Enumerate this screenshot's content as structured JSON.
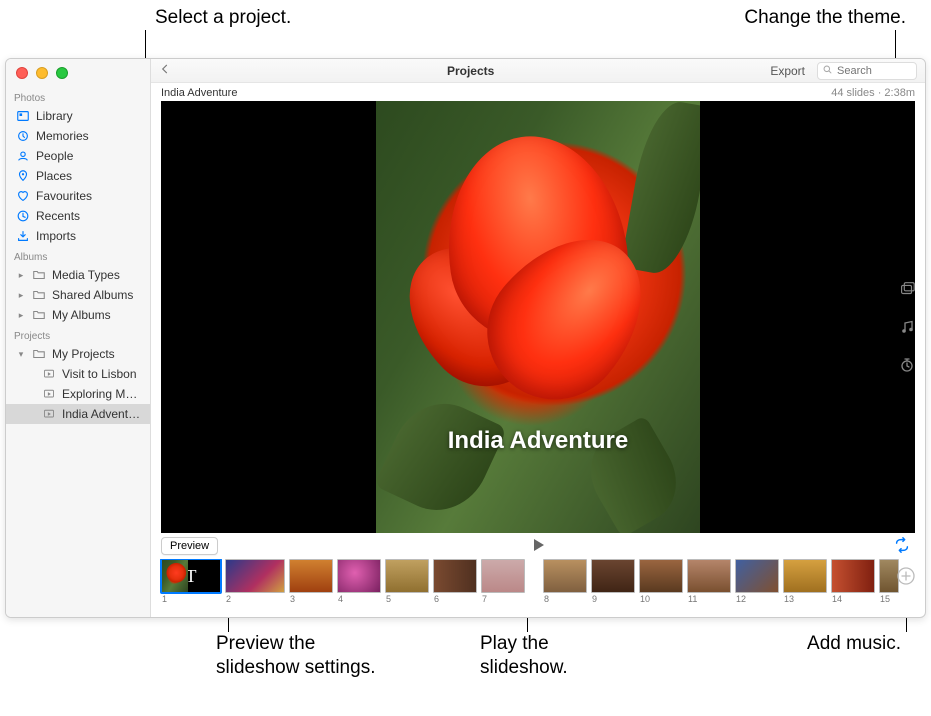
{
  "callouts": {
    "select_project": "Select a project.",
    "change_theme": "Change the theme.",
    "preview": "Preview the\nslideshow settings.",
    "play": "Play the\nslideshow.",
    "add_music": "Add music."
  },
  "window": {
    "toolbar": {
      "title": "Projects",
      "export": "Export",
      "search_placeholder": "Search"
    },
    "project": {
      "name": "India Adventure",
      "meta": "44 slides · 2:38m",
      "stage_title": "India Adventure"
    },
    "controls": {
      "preview": "Preview"
    },
    "thumbs": {
      "title_glyph": "T",
      "numbers": [
        "1",
        "2",
        "3",
        "4",
        "5",
        "6",
        "7",
        "8",
        "9",
        "10",
        "11",
        "12",
        "13",
        "14",
        "15"
      ]
    }
  },
  "sidebar": {
    "sections": {
      "photos": "Photos",
      "albums": "Albums",
      "projects": "Projects"
    },
    "photos_items": [
      {
        "label": "Library",
        "icon": "library"
      },
      {
        "label": "Memories",
        "icon": "memories"
      },
      {
        "label": "People",
        "icon": "people"
      },
      {
        "label": "Places",
        "icon": "places"
      },
      {
        "label": "Favourites",
        "icon": "heart"
      },
      {
        "label": "Recents",
        "icon": "clock"
      },
      {
        "label": "Imports",
        "icon": "import"
      }
    ],
    "albums_items": [
      {
        "label": "Media Types"
      },
      {
        "label": "Shared Albums"
      },
      {
        "label": "My Albums"
      }
    ],
    "projects_root": "My Projects",
    "project_items": [
      {
        "label": "Visit to Lisbon"
      },
      {
        "label": "Exploring Mor…"
      },
      {
        "label": "India Adventure",
        "selected": true
      }
    ]
  }
}
